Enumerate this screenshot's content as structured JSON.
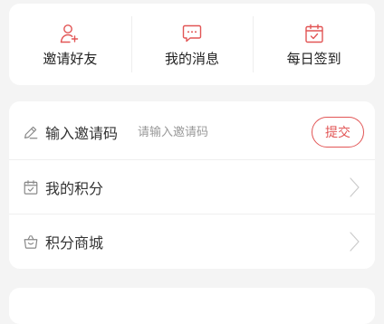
{
  "quick_actions": [
    {
      "label": "邀请好友",
      "icon": "add-user-icon"
    },
    {
      "label": "我的消息",
      "icon": "message-icon"
    },
    {
      "label": "每日签到",
      "icon": "calendar-check-icon"
    }
  ],
  "invite": {
    "label": "输入邀请码",
    "placeholder": "请输入邀请码",
    "value": "",
    "submit_label": "提交",
    "icon": "pencil-icon"
  },
  "menu": [
    {
      "label": "我的积分",
      "icon": "calendar-check-icon"
    },
    {
      "label": "积分商城",
      "icon": "shopping-basket-icon"
    }
  ],
  "colors": {
    "accent": "#e25555",
    "icon_gray": "#888888",
    "background": "#f4f4f4"
  }
}
